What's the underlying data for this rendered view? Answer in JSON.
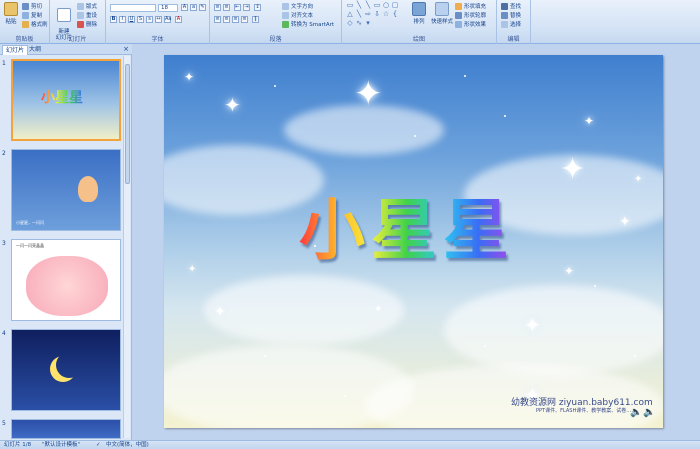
{
  "ribbon": {
    "clipboard": {
      "label": "剪贴板",
      "paste": "粘贴",
      "cut": "剪切",
      "copy": "复制",
      "format_painter": "格式刷"
    },
    "slides": {
      "label": "幻灯片",
      "new_slide": "新建\n幻灯片",
      "layout": "版式",
      "reset": "重设",
      "delete": "删除"
    },
    "font": {
      "label": "字体",
      "font_size": "18"
    },
    "paragraph": {
      "label": "段落",
      "text_direction": "文字方向",
      "align_text": "对齐文本",
      "smartart": "转换为 SmartArt"
    },
    "drawing": {
      "label": "绘图",
      "arrange": "排列",
      "quick_styles": "快速样式",
      "shape_fill": "形状填充",
      "shape_outline": "形状轮廓",
      "shape_effects": "形状效果"
    },
    "editing": {
      "label": "编辑",
      "find": "查找",
      "replace": "替换",
      "select": "选择"
    }
  },
  "pane": {
    "tab_slides": "幻灯片",
    "tab_outline": "大纲",
    "close": "×",
    "thumbs": [
      {
        "num": "1",
        "text": "小星星"
      },
      {
        "num": "2",
        "text": "小星星，一闪闪"
      },
      {
        "num": "3",
        "text": "一闪一闪亮晶晶"
      },
      {
        "num": "4",
        "text": ""
      },
      {
        "num": "5",
        "text": ""
      }
    ]
  },
  "slide": {
    "title": "小星星",
    "watermark_main": "幼教资源网 ziyuan.baby611.com",
    "watermark_sub": "PPT课件、FLASH课件、教学教案、试卷……"
  },
  "status": {
    "slide_info": "幻灯片 1/8",
    "theme": "\"默认设计模板\"",
    "language": "中文(简体，中国)"
  },
  "colors": {
    "ribbon_bg": "#d3e2f5",
    "selected_border": "#f2a33a",
    "pane_bg": "#dbe7f6"
  }
}
